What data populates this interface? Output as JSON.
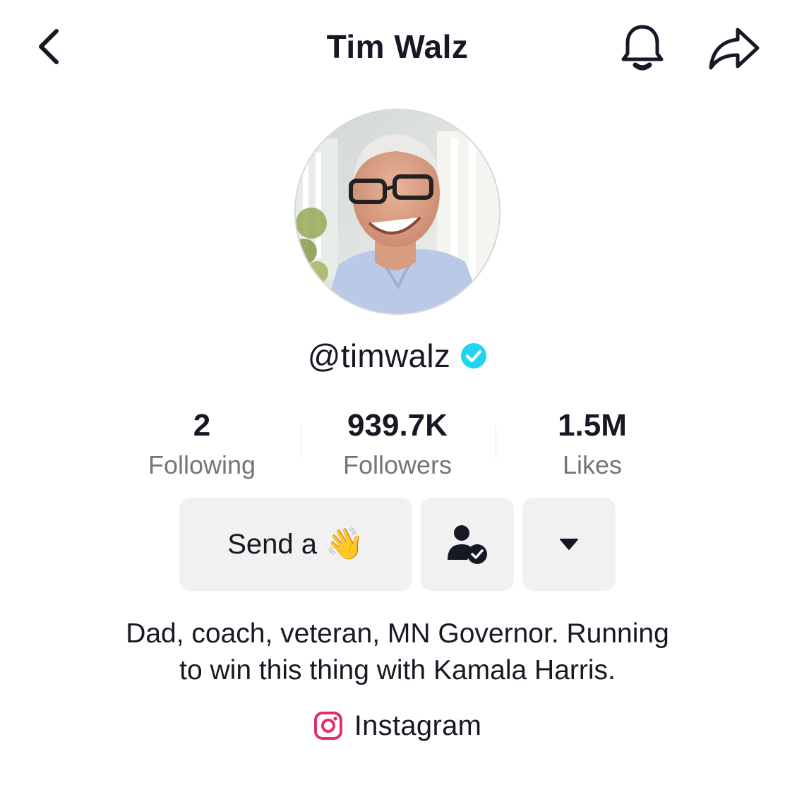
{
  "header": {
    "title": "Tim Walz",
    "back_icon": "chevron-left-icon",
    "notification_icon": "bell-icon",
    "share_icon": "share-arrow-icon"
  },
  "profile": {
    "avatar_alt": "Profile photo",
    "username": "@timwalz",
    "verified": true,
    "verified_color": "#20D5EC"
  },
  "stats": [
    {
      "value": "2",
      "label": "Following"
    },
    {
      "value": "939.7K",
      "label": "Followers"
    },
    {
      "value": "1.5M",
      "label": "Likes"
    }
  ],
  "actions": {
    "send_label": "Send a",
    "send_emoji": "👋",
    "friend_icon": "user-check-icon",
    "more_icon": "caret-down-icon"
  },
  "bio": {
    "text": "Dad, coach, veteran, MN Governor. Running\nto win this thing with Kamala Harris."
  },
  "link": {
    "icon": "instagram-icon",
    "label": "Instagram",
    "icon_color": "#E1306C"
  },
  "colors": {
    "text_primary": "#161823",
    "text_secondary": "#737579",
    "button_bg": "#F1F1F2"
  }
}
